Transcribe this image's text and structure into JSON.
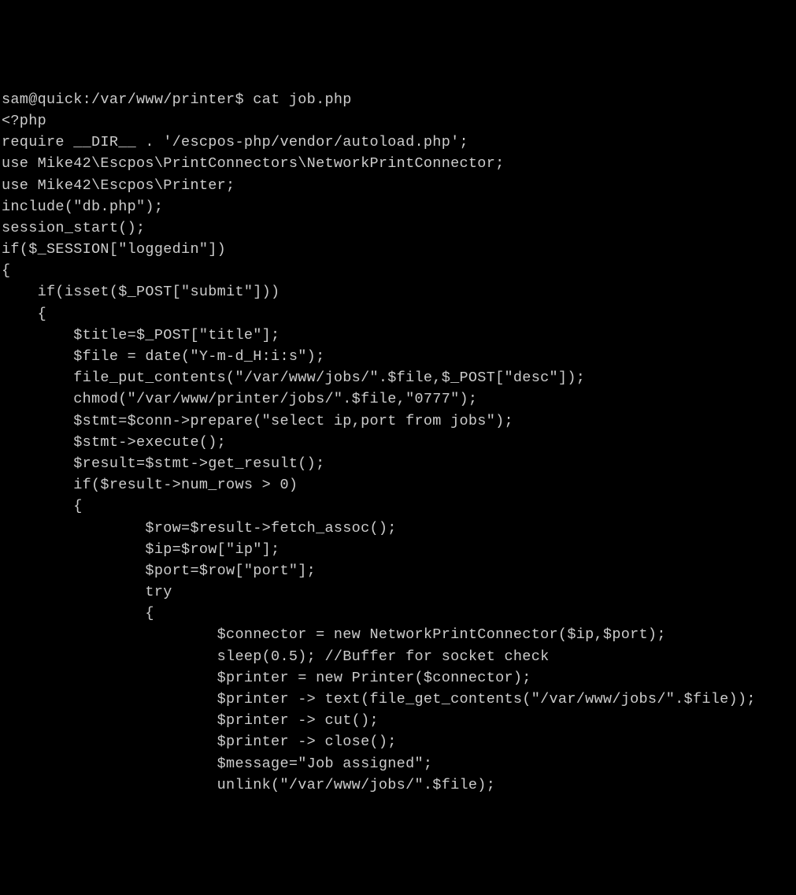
{
  "terminal": {
    "prompt": "sam@quick:/var/www/printer$ ",
    "command": "cat job.php",
    "lines": [
      "<?php",
      "require __DIR__ . '/escpos-php/vendor/autoload.php';",
      "use Mike42\\Escpos\\PrintConnectors\\NetworkPrintConnector;",
      "use Mike42\\Escpos\\Printer;",
      "include(\"db.php\");",
      "session_start();",
      "",
      "if($_SESSION[\"loggedin\"])",
      "{",
      "    if(isset($_POST[\"submit\"]))",
      "    {",
      "        $title=$_POST[\"title\"];",
      "        $file = date(\"Y-m-d_H:i:s\");",
      "        file_put_contents(\"/var/www/jobs/\".$file,$_POST[\"desc\"]);",
      "        chmod(\"/var/www/printer/jobs/\".$file,\"0777\");",
      "        $stmt=$conn->prepare(\"select ip,port from jobs\");",
      "        $stmt->execute();",
      "        $result=$stmt->get_result();",
      "        if($result->num_rows > 0)",
      "        {",
      "                $row=$result->fetch_assoc();",
      "                $ip=$row[\"ip\"];",
      "                $port=$row[\"port\"];",
      "                try",
      "                {",
      "                        $connector = new NetworkPrintConnector($ip,$port);",
      "                        sleep(0.5); //Buffer for socket check",
      "                        $printer = new Printer($connector);",
      "                        $printer -> text(file_get_contents(\"/var/www/jobs/\".$file));",
      "                        $printer -> cut();",
      "                        $printer -> close();",
      "                        $message=\"Job assigned\";",
      "                        unlink(\"/var/www/jobs/\".$file);"
    ]
  }
}
